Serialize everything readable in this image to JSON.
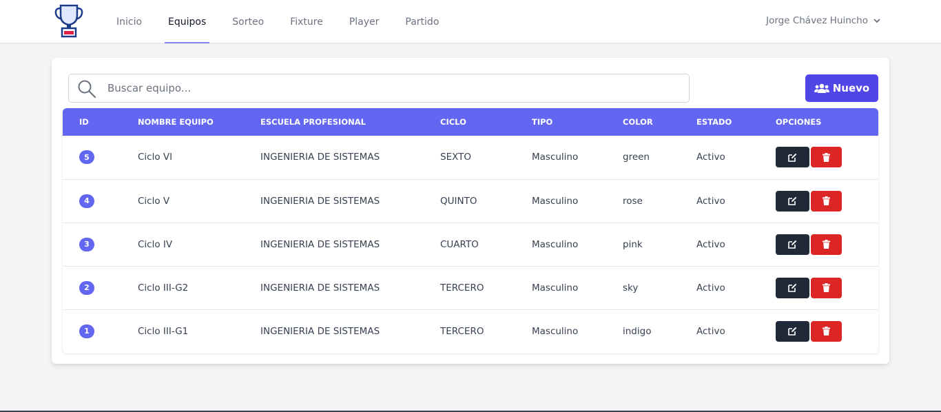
{
  "nav": {
    "logo_icon": "trophy-icon",
    "links": [
      "Inicio",
      "Equipos",
      "Sorteo",
      "Fixture",
      "Player",
      "Partido"
    ],
    "active": "Equipos",
    "user_name": "Jorge Chávez Huincho"
  },
  "search": {
    "placeholder": "Buscar equipo...",
    "value": ""
  },
  "new_button_label": "Nuevo",
  "table": {
    "headers": [
      "ID",
      "NOMBRE EQUIPO",
      "ESCUELA PROFESIONAL",
      "CICLO",
      "TIPO",
      "COLOR",
      "ESTADO",
      "OPCIONES"
    ],
    "rows": [
      {
        "id": "5",
        "nombre": "Ciclo VI",
        "escuela": "INGENIERIA DE SISTEMAS",
        "ciclo": "SEXTO",
        "tipo": "Masculino",
        "color": "green",
        "estado": "Activo"
      },
      {
        "id": "4",
        "nombre": "Ciclo V",
        "escuela": "INGENIERIA DE SISTEMAS",
        "ciclo": "QUINTO",
        "tipo": "Masculino",
        "color": "rose",
        "estado": "Activo"
      },
      {
        "id": "3",
        "nombre": "Ciclo IV",
        "escuela": "INGENIERIA DE SISTEMAS",
        "ciclo": "CUARTO",
        "tipo": "Masculino",
        "color": "pink",
        "estado": "Activo"
      },
      {
        "id": "2",
        "nombre": "Ciclo III-G2",
        "escuela": "INGENIERIA DE SISTEMAS",
        "ciclo": "TERCERO",
        "tipo": "Masculino",
        "color": "sky",
        "estado": "Activo"
      },
      {
        "id": "1",
        "nombre": "Ciclo III-G1",
        "escuela": "INGENIERIA DE SISTEMAS",
        "ciclo": "TERCERO",
        "tipo": "Masculino",
        "color": "indigo",
        "estado": "Activo"
      }
    ]
  },
  "colors": {
    "primary": "#6366f1",
    "button_primary": "#4f46e5",
    "edit": "#1f2937",
    "delete": "#dc2626"
  }
}
